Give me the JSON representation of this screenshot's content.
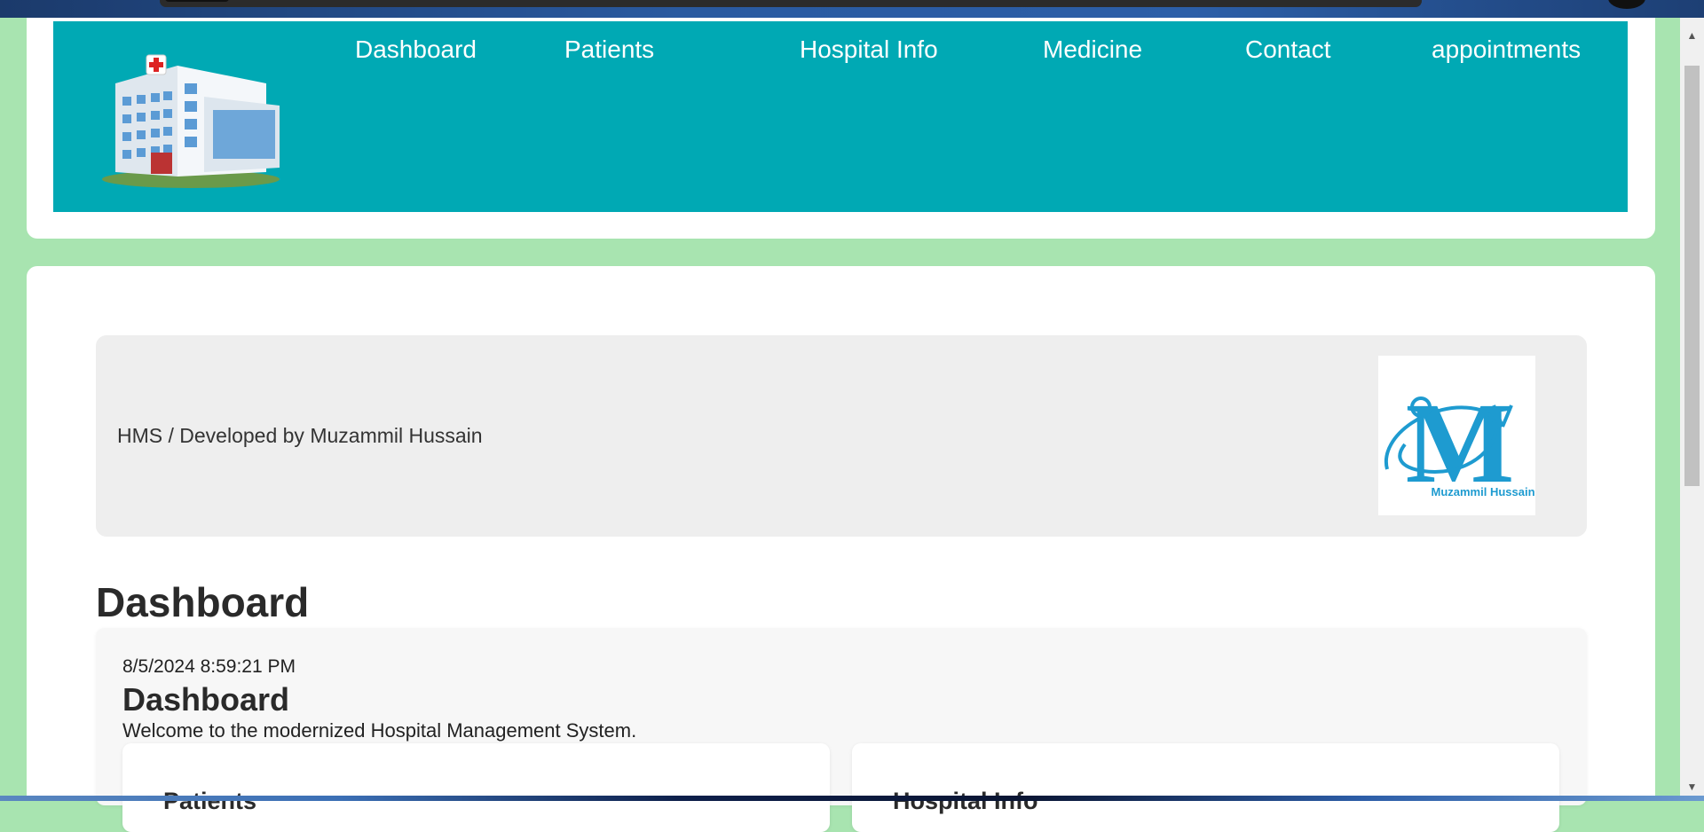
{
  "nav": {
    "items": [
      {
        "label": "Dashboard"
      },
      {
        "label": "Patients"
      },
      {
        "label": "Hospital Info"
      },
      {
        "label": "Medicine"
      },
      {
        "label": "Contact"
      },
      {
        "label": "appointments"
      }
    ]
  },
  "icons": {
    "logo": "hospital-building-icon",
    "brand": "muzammil-hussain-logo"
  },
  "banner": {
    "text": "HMS / Developed by Muzammil Hussain",
    "brand_logo_text": "Muzammil Hussain"
  },
  "page": {
    "title": "Dashboard"
  },
  "dashboard": {
    "timestamp": "8/5/2024 8:59:21 PM",
    "title": "Dashboard",
    "welcome": "Welcome to the modernized Hospital Management System.",
    "cards": [
      {
        "title": "Patients"
      },
      {
        "title": "Hospital Info"
      }
    ]
  },
  "colors": {
    "page_bg": "#a8e4b0",
    "header_bar": "#00a9b4",
    "banner_bg": "#eeeeee",
    "brand_blue": "#1e9bd0"
  }
}
